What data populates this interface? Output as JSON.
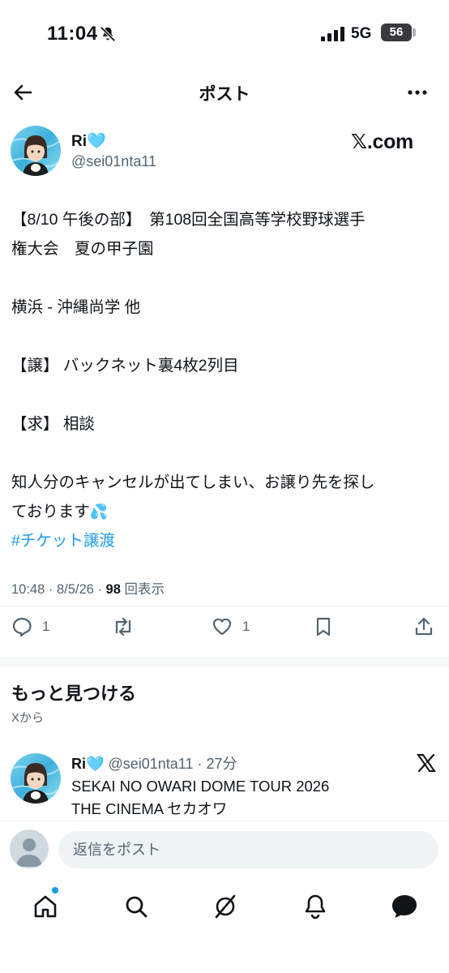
{
  "status_bar": {
    "time": "11:04",
    "network": "5G",
    "battery": "56",
    "battery_level_percent": 56
  },
  "nav": {
    "title": "ポスト"
  },
  "post": {
    "author_name": "Ri",
    "author_emoji": "🩵",
    "author_handle": "@sei01nta11",
    "source_logo": "𝕏.com",
    "lines": [
      "【8/10 午後の部】　第108回全国高等学校野球選手",
      "権大会　夏の甲子園",
      "",
      "横浜 - 沖縄尚学 他",
      "",
      "【譲】 バックネット裏4枚2列目",
      "",
      "【求】 相談",
      "",
      "知人分のキャンセルが出てしまい、お譲り先を探し",
      "ております"
    ],
    "sweat_emoji": "💦",
    "hashtag": "#チケット譲渡",
    "time": "10:48",
    "date": "8/5/26",
    "views": "98",
    "views_label": "回表示"
  },
  "actions": {
    "reply_count": "1",
    "like_count": "1"
  },
  "discover": {
    "title": "もっと見つける",
    "subtitle": "Xから",
    "rec_name": "Ri🩵",
    "rec_meta": "@sei01nta11 · 27分",
    "rec_line1": "SEKAI NO OWARI DOME TOUR 2026",
    "rec_line2": "THE CINEMA セカオワ"
  },
  "reply": {
    "placeholder": "返信をポスト"
  },
  "colors": {
    "accent": "#1d9bf0",
    "text": "#0f1419",
    "muted": "#536471"
  },
  "icons": [
    "back-arrow-icon",
    "more-icon",
    "reply-icon",
    "repost-icon",
    "like-icon",
    "bookmark-icon",
    "share-icon",
    "x-logo-icon",
    "home-icon",
    "search-icon",
    "grok-icon",
    "bell-icon",
    "message-icon"
  ]
}
